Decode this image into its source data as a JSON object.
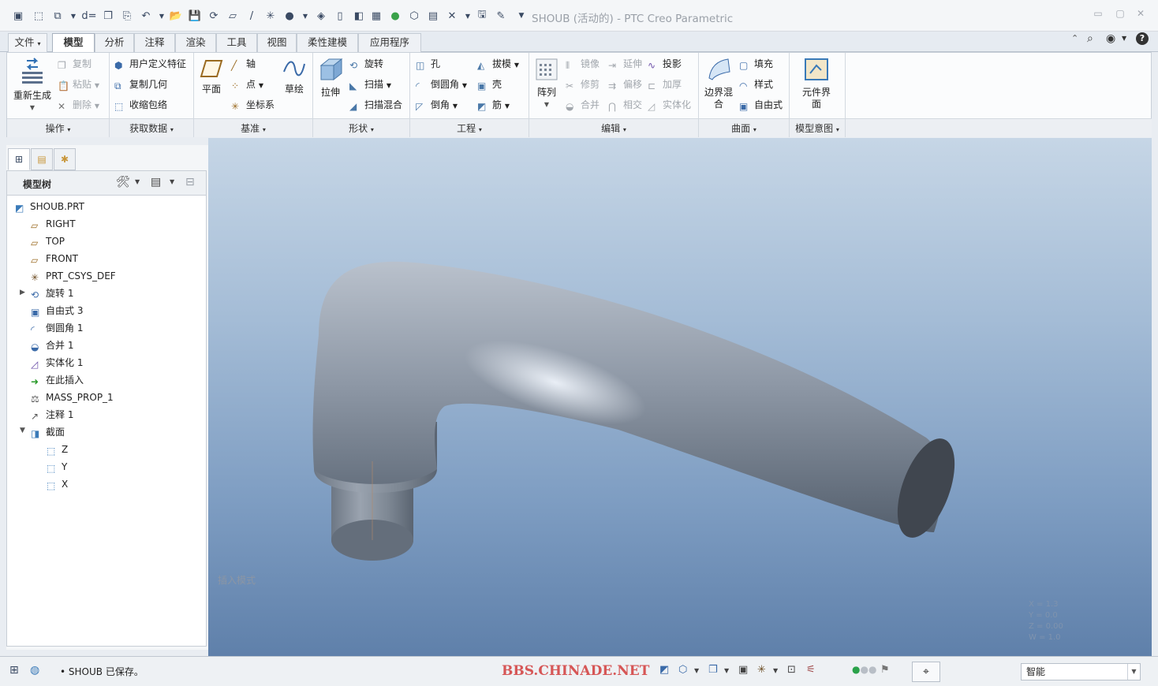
{
  "window": {
    "title": "SHOUB (活动的) - PTC Creo Parametric"
  },
  "ribbon": {
    "tabs": [
      {
        "label": "文件",
        "kind": "file"
      },
      {
        "label": "模型",
        "active": true
      },
      {
        "label": "分析"
      },
      {
        "label": "注释"
      },
      {
        "label": "渲染"
      },
      {
        "label": "工具"
      },
      {
        "label": "视图"
      },
      {
        "label": "柔性建模"
      },
      {
        "label": "应用程序"
      }
    ],
    "groups": {
      "operations": {
        "label": "操作",
        "regenerate": "重新生成",
        "copy": "复制",
        "paste": "粘贴",
        "delete": "删除"
      },
      "get_data": {
        "label": "获取数据",
        "udf": "用户定义特征",
        "copy_geom": "复制几何",
        "shrinkwrap": "收缩包络"
      },
      "datum": {
        "label": "基准",
        "plane": "平面",
        "axis": "轴",
        "point": "点",
        "csys": "坐标系",
        "sketch": "草绘"
      },
      "shapes": {
        "label": "形状",
        "extrude": "拉伸",
        "revolve": "旋转",
        "sweep": "扫描",
        "swept_blend": "扫描混合"
      },
      "engineering": {
        "label": "工程",
        "hole": "孔",
        "round": "倒圆角",
        "chamfer": "倒角",
        "draft": "拔模",
        "shell": "壳",
        "rib": "筋"
      },
      "editing": {
        "label": "编辑",
        "pattern": "阵列",
        "mirror": "镜像",
        "trim": "修剪",
        "merge": "合并",
        "extend": "延伸",
        "offset": "偏移",
        "intersect": "相交",
        "project": "投影",
        "thicken": "加厚",
        "solidify": "实体化"
      },
      "surfaces": {
        "label": "曲面",
        "boundary_blend": "边界混合",
        "fill": "填充",
        "style": "样式",
        "freestyle": "自由式"
      },
      "model_intent": {
        "label": "模型意图",
        "component_interface": "元件界面"
      }
    }
  },
  "model_tree": {
    "title": "模型树",
    "nodes": [
      {
        "label": "SHOUB.PRT",
        "icon": "part-icon"
      },
      {
        "label": "RIGHT",
        "icon": "datum-plane-icon"
      },
      {
        "label": "TOP",
        "icon": "datum-plane-icon"
      },
      {
        "label": "FRONT",
        "icon": "datum-plane-icon"
      },
      {
        "label": "PRT_CSYS_DEF",
        "icon": "csys-icon"
      },
      {
        "label": "旋转 1",
        "icon": "revolve-icon",
        "expandable": true,
        "expanded": false
      },
      {
        "label": "自由式 3",
        "icon": "freestyle-icon"
      },
      {
        "label": "倒圆角 1",
        "icon": "round-icon"
      },
      {
        "label": "合并 1",
        "icon": "merge-icon"
      },
      {
        "label": "实体化 1",
        "icon": "solidify-icon"
      },
      {
        "label": "在此插入",
        "icon": "insert-here-icon"
      },
      {
        "label": "MASS_PROP_1",
        "icon": "mass-prop-icon"
      },
      {
        "label": "注释 1",
        "icon": "annotation-icon"
      },
      {
        "label": "截面",
        "icon": "section-icon",
        "expandable": true,
        "expanded": true
      },
      {
        "label": "Z",
        "icon": "xsec-icon",
        "child": true
      },
      {
        "label": "Y",
        "icon": "xsec-icon",
        "child": true
      },
      {
        "label": "X",
        "icon": "xsec-icon",
        "child": true
      }
    ]
  },
  "viewport": {
    "insert_mode": "插入模式",
    "coords": [
      "X = 1.3",
      "Y = 0.0",
      "Z = 0.00",
      "W = 1.0"
    ]
  },
  "statusbar": {
    "message": "SHOUB 已保存。",
    "watermark": "BBS.CHINADE.NET",
    "filter": "智能"
  },
  "colors": {
    "viewport_top": "#c6d6e6",
    "viewport_bottom": "#5f80aa",
    "part_surface": "#8e98a6",
    "watermark": "#d23b3b"
  }
}
